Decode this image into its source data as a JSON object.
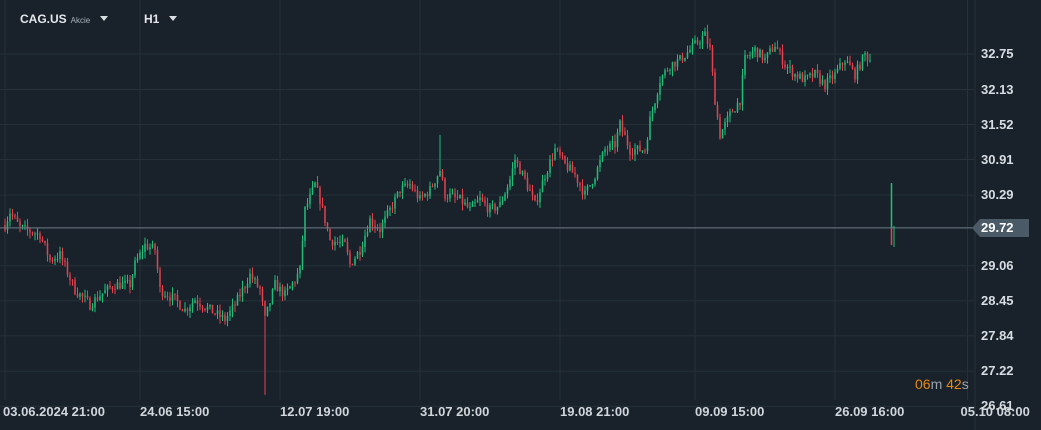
{
  "header": {
    "symbol": "CAG.US",
    "asset_type": "Akcie",
    "timeframe": "H1"
  },
  "countdown": {
    "minutes": "06",
    "m": "m",
    "seconds": "42",
    "s": "s"
  },
  "colors": {
    "up": "#1fbf7a",
    "down": "#e5414f",
    "grid": "#253039",
    "background": "#19222a",
    "price_line": "#6b7a86"
  },
  "chart_data": {
    "type": "candlestick",
    "title": "CAG.US H1",
    "ylim": [
      26.72,
      33.69
    ],
    "y_ticks": [
      "32.75",
      "32.13",
      "31.52",
      "30.91",
      "30.29",
      "29.72",
      "29.06",
      "28.45",
      "27.84",
      "27.22",
      "26.61"
    ],
    "y_tick_values": [
      32.75,
      32.13,
      31.52,
      30.91,
      30.29,
      29.72,
      29.06,
      28.45,
      27.84,
      27.22,
      26.61
    ],
    "x_ticks": [
      {
        "label": "03.06.2024  21:00",
        "bar": 0
      },
      {
        "label": "24.06  15:00",
        "bar": 54
      },
      {
        "label": "12.07  19:00",
        "bar": 110
      },
      {
        "label": "31.07  20:00",
        "bar": 166
      },
      {
        "label": "19.08  21:00",
        "bar": 222
      },
      {
        "label": "09.09  15:00",
        "bar": 276
      },
      {
        "label": "26.09  16:00",
        "bar": 332
      },
      {
        "label": "05.10  08:00",
        "bar": 385
      }
    ],
    "current_price": "29.72",
    "current_price_value": 29.72,
    "key_closes": [
      [
        0,
        29.77
      ],
      [
        2,
        30.0
      ],
      [
        6,
        29.72
      ],
      [
        14,
        29.6
      ],
      [
        18,
        29.16
      ],
      [
        22,
        29.25
      ],
      [
        28,
        28.64
      ],
      [
        34,
        28.38
      ],
      [
        38,
        28.55
      ],
      [
        44,
        28.73
      ],
      [
        50,
        28.73
      ],
      [
        52,
        29.08
      ],
      [
        56,
        29.42
      ],
      [
        60,
        29.34
      ],
      [
        62,
        28.64
      ],
      [
        68,
        28.47
      ],
      [
        72,
        28.29
      ],
      [
        76,
        28.47
      ],
      [
        82,
        28.29
      ],
      [
        88,
        28.12
      ],
      [
        92,
        28.38
      ],
      [
        98,
        28.9
      ],
      [
        102,
        28.64
      ],
      [
        104,
        28.12
      ],
      [
        108,
        28.73
      ],
      [
        112,
        28.55
      ],
      [
        116,
        28.81
      ],
      [
        118,
        28.99
      ],
      [
        120,
        30.03
      ],
      [
        124,
        30.47
      ],
      [
        126,
        30.21
      ],
      [
        130,
        29.51
      ],
      [
        136,
        29.42
      ],
      [
        138,
        29.08
      ],
      [
        142,
        29.34
      ],
      [
        146,
        29.86
      ],
      [
        150,
        29.69
      ],
      [
        154,
        30.03
      ],
      [
        158,
        30.38
      ],
      [
        162,
        30.47
      ],
      [
        166,
        30.21
      ],
      [
        170,
        30.38
      ],
      [
        174,
        30.73
      ],
      [
        176,
        30.3
      ],
      [
        182,
        30.21
      ],
      [
        186,
        30.03
      ],
      [
        190,
        30.21
      ],
      [
        194,
        30.03
      ],
      [
        198,
        30.12
      ],
      [
        202,
        30.56
      ],
      [
        204,
        30.91
      ],
      [
        208,
        30.56
      ],
      [
        212,
        30.12
      ],
      [
        216,
        30.64
      ],
      [
        220,
        31.08
      ],
      [
        224,
        30.82
      ],
      [
        228,
        30.64
      ],
      [
        232,
        30.3
      ],
      [
        236,
        30.64
      ],
      [
        240,
        31.08
      ],
      [
        244,
        31.17
      ],
      [
        246,
        31.52
      ],
      [
        250,
        31.08
      ],
      [
        256,
        31.08
      ],
      [
        258,
        31.6
      ],
      [
        262,
        32.3
      ],
      [
        266,
        32.56
      ],
      [
        270,
        32.65
      ],
      [
        274,
        32.82
      ],
      [
        278,
        33.0
      ],
      [
        280,
        33.08
      ],
      [
        282,
        32.82
      ],
      [
        284,
        31.95
      ],
      [
        286,
        31.34
      ],
      [
        290,
        31.69
      ],
      [
        294,
        31.95
      ],
      [
        296,
        32.65
      ],
      [
        300,
        32.82
      ],
      [
        304,
        32.65
      ],
      [
        308,
        32.91
      ],
      [
        312,
        32.56
      ],
      [
        316,
        32.39
      ],
      [
        320,
        32.3
      ],
      [
        324,
        32.39
      ],
      [
        328,
        32.21
      ],
      [
        332,
        32.39
      ],
      [
        336,
        32.65
      ],
      [
        340,
        32.39
      ],
      [
        344,
        32.74
      ],
      [
        346,
        32.65
      ]
    ],
    "special_wicks": [
      {
        "bar": 104,
        "low": 26.81
      },
      {
        "bar": 174,
        "high": 31.34
      }
    ],
    "current_candle": {
      "bar": 347,
      "open": 29.72,
      "high": 30.5,
      "low": 29.42,
      "close": 29.72
    }
  }
}
